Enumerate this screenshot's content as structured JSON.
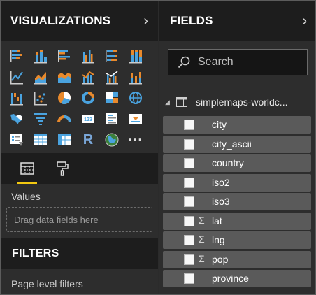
{
  "visualizations": {
    "title": "VISUALIZATIONS",
    "expand_icon": "chevron-right-icon",
    "icons": [
      "stacked-bar-chart-icon",
      "stacked-column-chart-icon",
      "clustered-bar-chart-icon",
      "clustered-column-chart-icon",
      "100-percent-stacked-bar-chart-icon",
      "100-percent-stacked-column-chart-icon",
      "line-chart-icon",
      "area-chart-icon",
      "stacked-area-chart-icon",
      "line-and-stacked-column-chart-icon",
      "line-and-clustered-column-chart-icon",
      "ribbon-chart-icon",
      "waterfall-chart-icon",
      "scatter-chart-icon",
      "pie-chart-icon",
      "donut-chart-icon",
      "treemap-icon",
      "map-icon",
      "filled-map-icon",
      "funnel-icon",
      "gauge-icon",
      "card-icon",
      "multi-row-card-icon",
      "kpi-icon",
      "slicer-icon",
      "table-icon",
      "matrix-icon",
      "r-script-visual-icon",
      "globe-map-icon",
      "more-visuals-icon"
    ],
    "r_label": "R",
    "more_label": "···",
    "tools": [
      "fields-well-icon",
      "format-paint-roller-icon"
    ],
    "values_label": "Values",
    "dropzone_text": "Drag data fields here"
  },
  "filters": {
    "title": "FILTERS",
    "page_level_label": "Page level filters"
  },
  "fields": {
    "title": "FIELDS",
    "expand_icon": "chevron-right-icon",
    "search_placeholder": "Search",
    "table_name": "simplemaps-worldc...",
    "items": [
      {
        "name": "city",
        "sigma": ""
      },
      {
        "name": "city_ascii",
        "sigma": ""
      },
      {
        "name": "country",
        "sigma": ""
      },
      {
        "name": "iso2",
        "sigma": ""
      },
      {
        "name": "iso3",
        "sigma": ""
      },
      {
        "name": "lat",
        "sigma": "Σ"
      },
      {
        "name": "lng",
        "sigma": "Σ"
      },
      {
        "name": "pop",
        "sigma": "Σ"
      },
      {
        "name": "province",
        "sigma": ""
      }
    ]
  },
  "colors": {
    "accent_yellow": "#f2c811",
    "bar_orange": "#e8892c",
    "bar_blue": "#4aa3df",
    "pane_bg": "#2d2d2d",
    "header_bg": "#1d1d1d",
    "field_row_bg": "#5a5a5a"
  }
}
